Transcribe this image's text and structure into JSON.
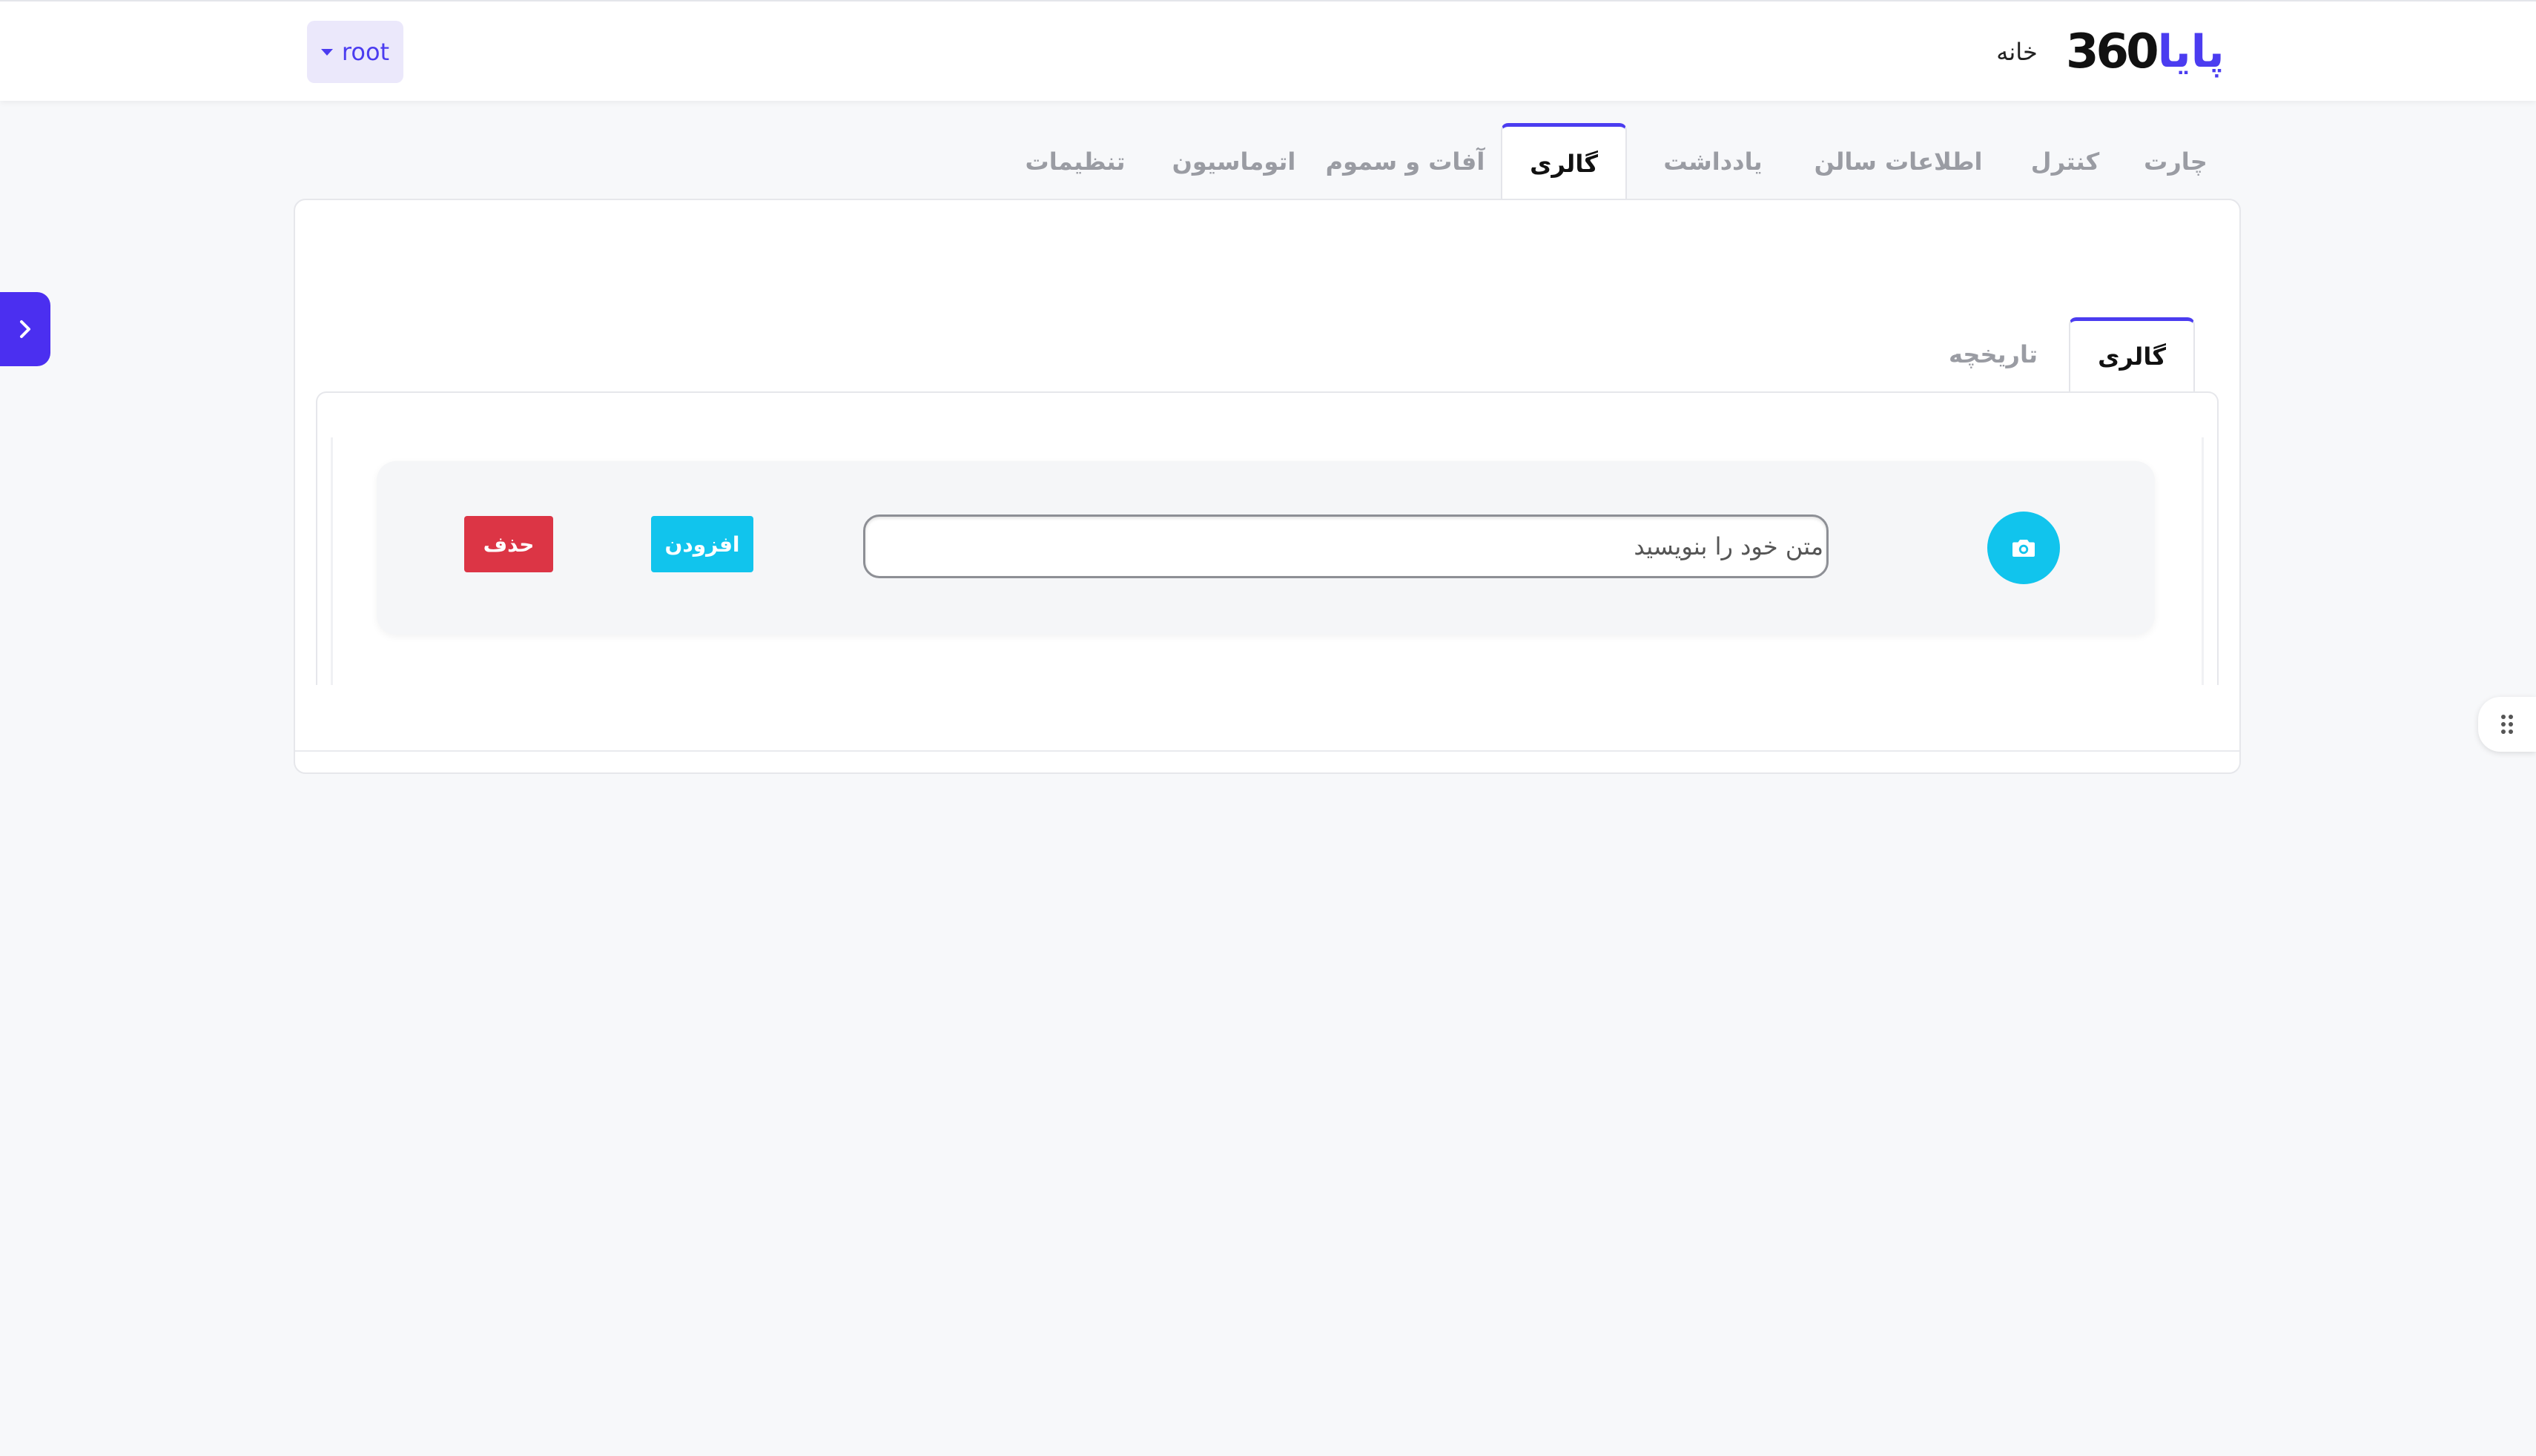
{
  "header": {
    "brand_number": "360",
    "brand_word": "پایا",
    "home_label": "خانه",
    "user_label": "root"
  },
  "main_tabs": [
    {
      "label": "چارت",
      "active": false
    },
    {
      "label": "کنترل",
      "active": false
    },
    {
      "label": "اطلاعات سالن",
      "active": false
    },
    {
      "label": "یادداشت",
      "active": false
    },
    {
      "label": "گالری",
      "active": true
    },
    {
      "label": "آفات و سموم",
      "active": false
    },
    {
      "label": "اتوماسیون",
      "active": false
    },
    {
      "label": "تنظیمات",
      "active": false
    }
  ],
  "inner_tabs": [
    {
      "label": "گالری",
      "active": true
    },
    {
      "label": "تاریخچه",
      "active": false
    }
  ],
  "gallery_row": {
    "input_placeholder": "متن خود را بنویسید",
    "input_value": "",
    "add_label": "افزودن",
    "delete_label": "حذف"
  },
  "colors": {
    "accent": "#4b3cf0",
    "info": "#11c4ed",
    "danger": "#dc3545"
  },
  "icons": {
    "sidebar_toggle": "chevron-right-icon",
    "camera": "camera-icon",
    "drag_handle": "drag-dots-icon",
    "user_menu": "caret-down-icon"
  }
}
